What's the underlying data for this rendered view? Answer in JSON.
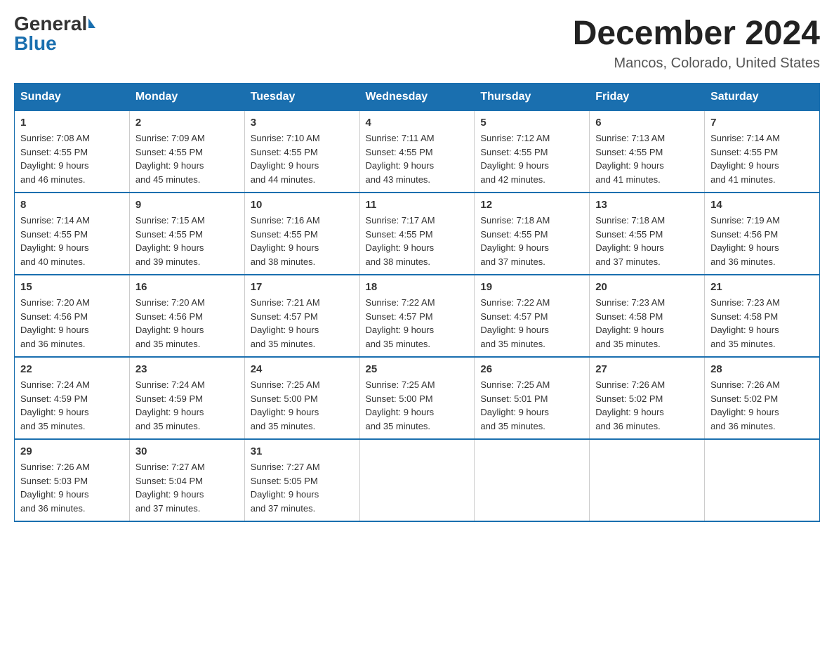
{
  "logo": {
    "general": "General",
    "blue": "Blue"
  },
  "title": "December 2024",
  "location": "Mancos, Colorado, United States",
  "headers": [
    "Sunday",
    "Monday",
    "Tuesday",
    "Wednesday",
    "Thursday",
    "Friday",
    "Saturday"
  ],
  "weeks": [
    [
      {
        "day": "1",
        "sunrise": "7:08 AM",
        "sunset": "4:55 PM",
        "daylight": "9 hours and 46 minutes."
      },
      {
        "day": "2",
        "sunrise": "7:09 AM",
        "sunset": "4:55 PM",
        "daylight": "9 hours and 45 minutes."
      },
      {
        "day": "3",
        "sunrise": "7:10 AM",
        "sunset": "4:55 PM",
        "daylight": "9 hours and 44 minutes."
      },
      {
        "day": "4",
        "sunrise": "7:11 AM",
        "sunset": "4:55 PM",
        "daylight": "9 hours and 43 minutes."
      },
      {
        "day": "5",
        "sunrise": "7:12 AM",
        "sunset": "4:55 PM",
        "daylight": "9 hours and 42 minutes."
      },
      {
        "day": "6",
        "sunrise": "7:13 AM",
        "sunset": "4:55 PM",
        "daylight": "9 hours and 41 minutes."
      },
      {
        "day": "7",
        "sunrise": "7:14 AM",
        "sunset": "4:55 PM",
        "daylight": "9 hours and 41 minutes."
      }
    ],
    [
      {
        "day": "8",
        "sunrise": "7:14 AM",
        "sunset": "4:55 PM",
        "daylight": "9 hours and 40 minutes."
      },
      {
        "day": "9",
        "sunrise": "7:15 AM",
        "sunset": "4:55 PM",
        "daylight": "9 hours and 39 minutes."
      },
      {
        "day": "10",
        "sunrise": "7:16 AM",
        "sunset": "4:55 PM",
        "daylight": "9 hours and 38 minutes."
      },
      {
        "day": "11",
        "sunrise": "7:17 AM",
        "sunset": "4:55 PM",
        "daylight": "9 hours and 38 minutes."
      },
      {
        "day": "12",
        "sunrise": "7:18 AM",
        "sunset": "4:55 PM",
        "daylight": "9 hours and 37 minutes."
      },
      {
        "day": "13",
        "sunrise": "7:18 AM",
        "sunset": "4:55 PM",
        "daylight": "9 hours and 37 minutes."
      },
      {
        "day": "14",
        "sunrise": "7:19 AM",
        "sunset": "4:56 PM",
        "daylight": "9 hours and 36 minutes."
      }
    ],
    [
      {
        "day": "15",
        "sunrise": "7:20 AM",
        "sunset": "4:56 PM",
        "daylight": "9 hours and 36 minutes."
      },
      {
        "day": "16",
        "sunrise": "7:20 AM",
        "sunset": "4:56 PM",
        "daylight": "9 hours and 35 minutes."
      },
      {
        "day": "17",
        "sunrise": "7:21 AM",
        "sunset": "4:57 PM",
        "daylight": "9 hours and 35 minutes."
      },
      {
        "day": "18",
        "sunrise": "7:22 AM",
        "sunset": "4:57 PM",
        "daylight": "9 hours and 35 minutes."
      },
      {
        "day": "19",
        "sunrise": "7:22 AM",
        "sunset": "4:57 PM",
        "daylight": "9 hours and 35 minutes."
      },
      {
        "day": "20",
        "sunrise": "7:23 AM",
        "sunset": "4:58 PM",
        "daylight": "9 hours and 35 minutes."
      },
      {
        "day": "21",
        "sunrise": "7:23 AM",
        "sunset": "4:58 PM",
        "daylight": "9 hours and 35 minutes."
      }
    ],
    [
      {
        "day": "22",
        "sunrise": "7:24 AM",
        "sunset": "4:59 PM",
        "daylight": "9 hours and 35 minutes."
      },
      {
        "day": "23",
        "sunrise": "7:24 AM",
        "sunset": "4:59 PM",
        "daylight": "9 hours and 35 minutes."
      },
      {
        "day": "24",
        "sunrise": "7:25 AM",
        "sunset": "5:00 PM",
        "daylight": "9 hours and 35 minutes."
      },
      {
        "day": "25",
        "sunrise": "7:25 AM",
        "sunset": "5:00 PM",
        "daylight": "9 hours and 35 minutes."
      },
      {
        "day": "26",
        "sunrise": "7:25 AM",
        "sunset": "5:01 PM",
        "daylight": "9 hours and 35 minutes."
      },
      {
        "day": "27",
        "sunrise": "7:26 AM",
        "sunset": "5:02 PM",
        "daylight": "9 hours and 36 minutes."
      },
      {
        "day": "28",
        "sunrise": "7:26 AM",
        "sunset": "5:02 PM",
        "daylight": "9 hours and 36 minutes."
      }
    ],
    [
      {
        "day": "29",
        "sunrise": "7:26 AM",
        "sunset": "5:03 PM",
        "daylight": "9 hours and 36 minutes."
      },
      {
        "day": "30",
        "sunrise": "7:27 AM",
        "sunset": "5:04 PM",
        "daylight": "9 hours and 37 minutes."
      },
      {
        "day": "31",
        "sunrise": "7:27 AM",
        "sunset": "5:05 PM",
        "daylight": "9 hours and 37 minutes."
      },
      null,
      null,
      null,
      null
    ]
  ],
  "labels": {
    "sunrise": "Sunrise:",
    "sunset": "Sunset:",
    "daylight": "Daylight:"
  }
}
